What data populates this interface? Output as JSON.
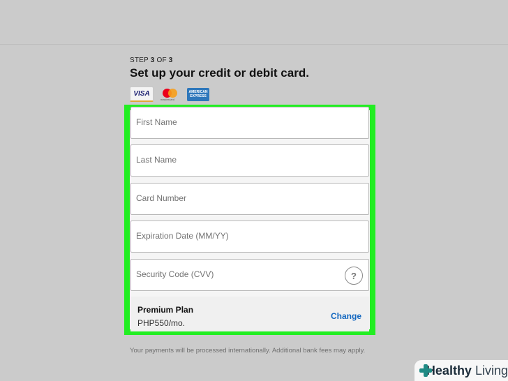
{
  "step": {
    "prefix": "STEP",
    "current": "3",
    "of_word": "OF",
    "total": "3"
  },
  "title": "Set up your credit or debit card.",
  "card_logos": [
    {
      "name": "visa",
      "text": "VISA",
      "color": "#1a1f71"
    },
    {
      "name": "mastercard",
      "text": "mastercard",
      "color": "#eb001b"
    },
    {
      "name": "amex",
      "text": "AMERICAN EXPRESS",
      "color": "#2e77bb"
    }
  ],
  "form": {
    "first_name_placeholder": "First Name",
    "last_name_placeholder": "Last Name",
    "card_number_placeholder": "Card Number",
    "expiration_placeholder": "Expiration Date (MM/YY)",
    "security_code_placeholder": "Security Code (CVV)",
    "help_glyph": "?"
  },
  "plan": {
    "name": "Premium Plan",
    "price": "PHP550/mo.",
    "change_label": "Change"
  },
  "note": "Your payments will be processed internationally. Additional bank fees may apply.",
  "watermark": {
    "brand_part1": "Healthy",
    "brand_part2": "Living"
  },
  "colors": {
    "highlight": "#22ee22",
    "link": "#1468c0",
    "background": "#cbcbcb"
  }
}
